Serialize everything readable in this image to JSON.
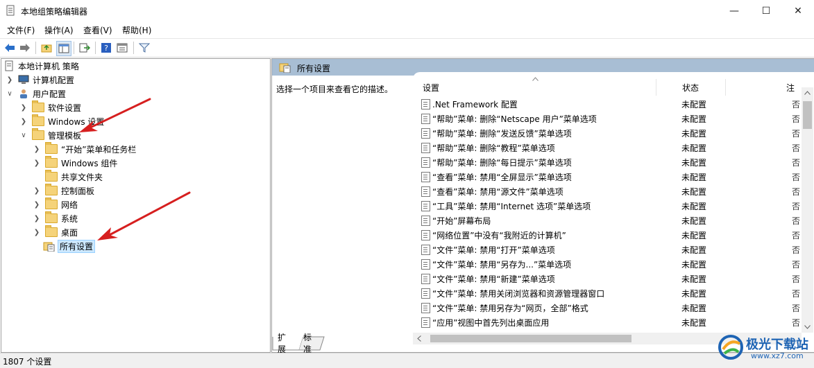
{
  "window": {
    "title": "本地组策略编辑器",
    "minimize_glyph": "—",
    "maximize_glyph": "☐",
    "close_glyph": "✕"
  },
  "menu": [
    "文件(F)",
    "操作(A)",
    "查看(V)",
    "帮助(H)"
  ],
  "toolbar": {
    "buttons": [
      "back-icon",
      "forward-icon",
      "up-folder-icon",
      "show-hide-tree-icon",
      "export-list-icon",
      "help-icon",
      "properties-icon",
      "filter-icon"
    ]
  },
  "tree": {
    "root": "本地计算机 策略",
    "computer_config": "计算机配置",
    "user_config": "用户配置",
    "software_settings": "软件设置",
    "windows_settings": "Windows 设置",
    "admin_templates": "管理模板",
    "children": [
      "“开始”菜单和任务栏",
      "Windows 组件",
      "共享文件夹",
      "控制面板",
      "网络",
      "系统",
      "桌面"
    ],
    "all_settings": "所有设置"
  },
  "right_pane": {
    "header": "所有设置",
    "description": "选择一个项目来查看它的描述。",
    "columns": {
      "setting": "设置",
      "state": "状态",
      "note": "注"
    },
    "rows": [
      {
        "label": ".Net Framework 配置",
        "state": "未配置",
        "note": "否"
      },
      {
        "label": "“帮助”菜单: 删除“Netscape 用户”菜单选项",
        "state": "未配置",
        "note": "否"
      },
      {
        "label": "“帮助”菜单: 删除“发送反馈”菜单选项",
        "state": "未配置",
        "note": "否"
      },
      {
        "label": "“帮助”菜单: 删除“教程”菜单选项",
        "state": "未配置",
        "note": "否"
      },
      {
        "label": "“帮助”菜单: 删除“每日提示”菜单选项",
        "state": "未配置",
        "note": "否"
      },
      {
        "label": "“查看”菜单: 禁用“全屏显示”菜单选项",
        "state": "未配置",
        "note": "否"
      },
      {
        "label": "“查看”菜单: 禁用“源文件”菜单选项",
        "state": "未配置",
        "note": "否"
      },
      {
        "label": "“工具”菜单: 禁用“Internet 选项”菜单选项",
        "state": "未配置",
        "note": "否"
      },
      {
        "label": "“开始”屏幕布局",
        "state": "未配置",
        "note": "否"
      },
      {
        "label": "“网络位置”中没有“我附近的计算机”",
        "state": "未配置",
        "note": "否"
      },
      {
        "label": "“文件”菜单: 禁用“打开”菜单选项",
        "state": "未配置",
        "note": "否"
      },
      {
        "label": "“文件”菜单: 禁用“另存为...”菜单选项",
        "state": "未配置",
        "note": "否"
      },
      {
        "label": "“文件”菜单: 禁用“新建”菜单选项",
        "state": "未配置",
        "note": "否"
      },
      {
        "label": "“文件”菜单: 禁用关闭浏览器和资源管理器窗口",
        "state": "未配置",
        "note": "否"
      },
      {
        "label": "“文件”菜单: 禁用另存为“网页，全部”格式",
        "state": "未配置",
        "note": "否"
      },
      {
        "label": "“应用”视图中首先列出桌面应用",
        "state": "未配置",
        "note": "否"
      }
    ]
  },
  "tabs": [
    "扩展",
    "标准"
  ],
  "status": "1807 个设置",
  "watermark": {
    "text": "极光下载站",
    "url": "www.xz7.com"
  },
  "colors": {
    "arrow": "#d61f1f",
    "header_bg": "#a8bed4",
    "selection": "#cce8ff"
  }
}
